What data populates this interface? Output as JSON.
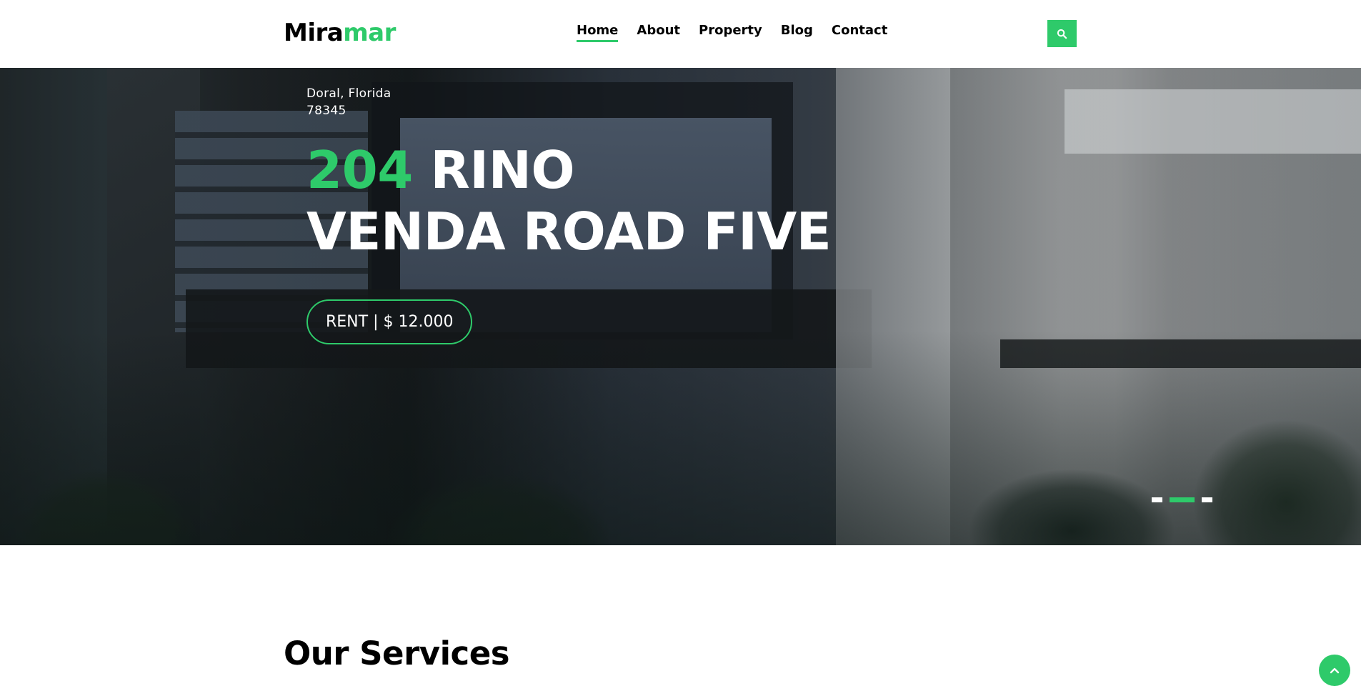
{
  "brand": {
    "part1": "Mira",
    "part2": "mar",
    "accent_color": "#2eca6a"
  },
  "nav": {
    "items": [
      {
        "label": "Home",
        "active": true
      },
      {
        "label": "About",
        "active": false
      },
      {
        "label": "Property",
        "active": false
      },
      {
        "label": "Blog",
        "active": false
      },
      {
        "label": "Contact",
        "active": false
      }
    ]
  },
  "search": {
    "icon": "search-icon"
  },
  "hero": {
    "address_line1": "Doral, Florida",
    "address_line2": "78345",
    "title_number": "204",
    "title_line1_rest": " RINO",
    "title_line2": "VENDA ROAD FIVE",
    "price_label": "RENT | $ 12.000",
    "slides": {
      "count": 3,
      "active_index": 1
    }
  },
  "services": {
    "title": "Our Services"
  },
  "back_to_top": {
    "icon": "chevron-up-icon"
  }
}
